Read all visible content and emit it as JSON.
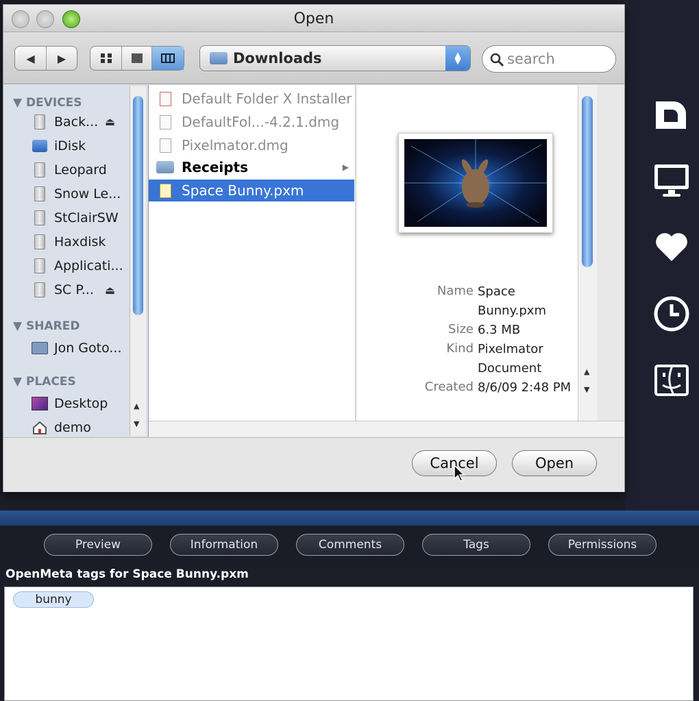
{
  "dialog": {
    "title": "Open",
    "path": "Downloads",
    "search_placeholder": "search",
    "cancel_label": "Cancel",
    "open_label": "Open"
  },
  "sidebar": {
    "devices_header": "DEVICES",
    "devices": [
      "Back...",
      "iDisk",
      "Leopard",
      "Snow Le...",
      "StClairSW",
      "Haxdisk",
      "Applicati...",
      "SC P..."
    ],
    "shared_header": "SHARED",
    "shared": [
      "Jon Goto..."
    ],
    "places_header": "PLACES",
    "places": [
      "Desktop",
      "demo"
    ]
  },
  "files": [
    {
      "name": "Default Folder X Installer",
      "kind": "doc",
      "state": "dim"
    },
    {
      "name": "DefaultFol...-4.2.1.dmg",
      "kind": "doc",
      "state": "dim"
    },
    {
      "name": "Pixelmator.dmg",
      "kind": "doc",
      "state": "dim"
    },
    {
      "name": "Receipts",
      "kind": "folder",
      "state": "normal"
    },
    {
      "name": "Space Bunny.pxm",
      "kind": "pxm",
      "state": "selected"
    }
  ],
  "preview": {
    "name_key": "Name",
    "name_val": "Space Bunny.pxm",
    "size_key": "Size",
    "size_val": "6.3 MB",
    "kind_key": "Kind",
    "kind_val": "Pixelmator Document",
    "created_key": "Created",
    "created_val": "8/6/09 2:48 PM"
  },
  "panel": {
    "tabs": [
      "Preview",
      "Information",
      "Comments",
      "Tags",
      "Permissions"
    ],
    "tags_caption": "OpenMeta tags for Space Bunny.pxm",
    "tag": "bunny"
  },
  "colors": {
    "selection": "#3975d6",
    "accent_blue": "#2c5590"
  }
}
